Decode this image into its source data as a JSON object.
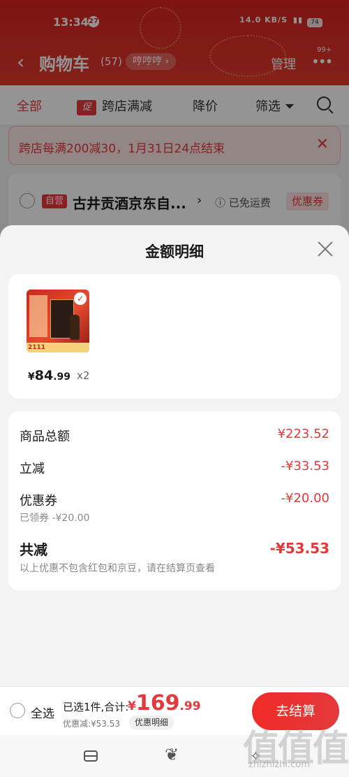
{
  "status": {
    "time": "13:34",
    "notif": "27",
    "net": "14.0 KB/S",
    "battery": "74"
  },
  "nav": {
    "title": "购物车",
    "count": "(57)",
    "address": "哼哼哼",
    "manage": "管理",
    "more_badge": "99+"
  },
  "tabs": {
    "all": "全部",
    "promo_icon": "促",
    "promo": "跨店满减",
    "price_drop": "降价",
    "filter": "筛选"
  },
  "banner": {
    "text": "跨店每满200减30，1月31日24点结束"
  },
  "store": {
    "tag": "自营",
    "name": "古井贡酒京东自...",
    "shipping": "已免运费",
    "coupon": "优惠券"
  },
  "sheet": {
    "title": "金额明细",
    "product": {
      "thumb_date": "2111",
      "price_symbol": "¥",
      "price_int": "84",
      "price_dec": ".99",
      "qty": "x2"
    },
    "rows": {
      "goods_label": "商品总额",
      "goods_value": "¥223.52",
      "direct_label": "立减",
      "direct_value": "-¥33.53",
      "coupon_label": "优惠券",
      "coupon_value": "-¥20.00",
      "coupon_sub": "已领券 -¥20.00",
      "total_label": "共减",
      "total_value": "-¥53.53",
      "note": "以上优惠不包含红包和京豆，请在结算页查看"
    }
  },
  "checkout": {
    "select_all": "全选",
    "selected": "已选1件,合计:",
    "amount_cur": "¥",
    "amount_int": "169",
    "amount_dec": ".99",
    "discount": "优惠减:¥53.53",
    "detail": "优惠明细",
    "button": "去结算"
  },
  "watermark": {
    "main": "值值值",
    "sub": "zhizhizhi.com"
  }
}
